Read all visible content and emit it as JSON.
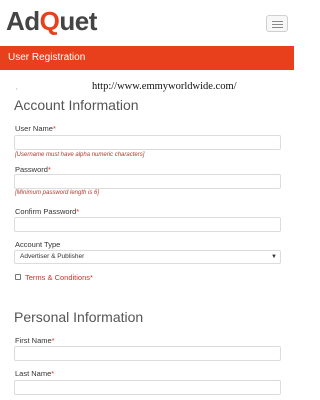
{
  "header": {
    "logo_part1": "Ad",
    "logo_part2": "Q",
    "logo_part3": "uet"
  },
  "banner": {
    "title": "User Registration"
  },
  "watermark_url": "http://www.emmyworldwide.com/",
  "account": {
    "heading": "Account Information",
    "username_label": "User Name",
    "username_hint": "[Username must have alpha numeric characters]",
    "password_label": "Password",
    "password_hint": "[Minimum password length is 6]",
    "confirm_label": "Confirm Password",
    "type_label": "Account Type",
    "type_value": "Advertiser & Publisher",
    "terms_label": "Terms & Conditions",
    "required_mark": "*"
  },
  "personal": {
    "heading": "Personal Information",
    "firstname_label": "First Name",
    "lastname_label": "Last Name"
  },
  "colors": {
    "brand": "#e8401c",
    "hint": "#b03a2e"
  },
  "icons": {
    "menu": "hamburger-icon",
    "dropdown": "caret-down-icon"
  }
}
